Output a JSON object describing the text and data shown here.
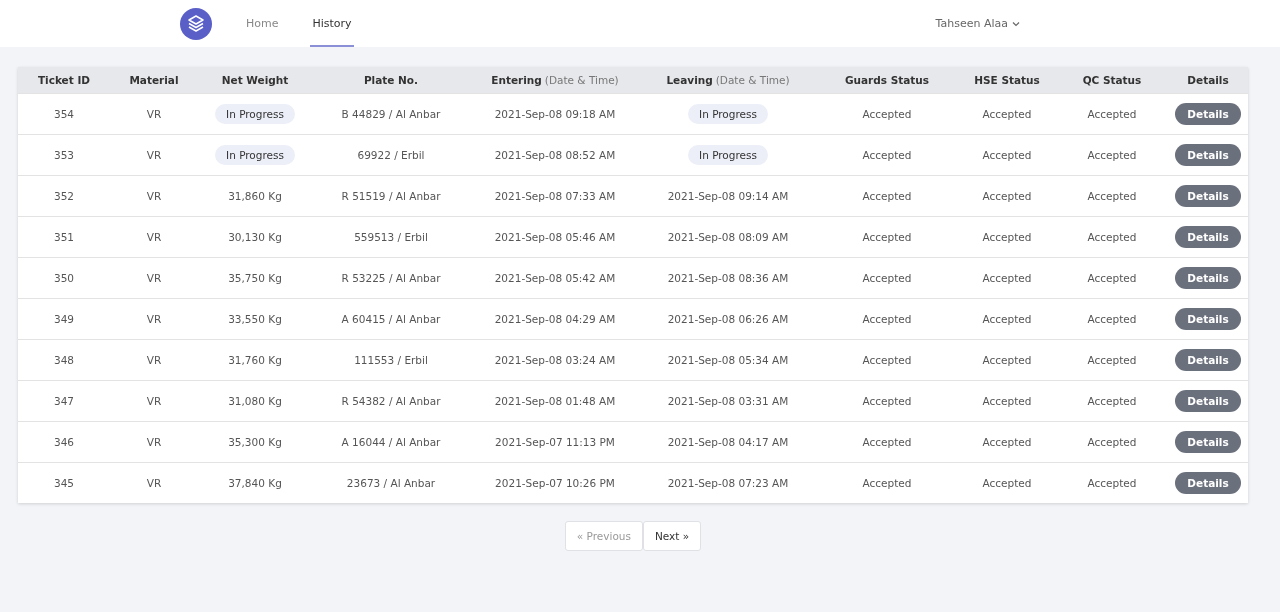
{
  "nav": {
    "links": [
      {
        "label": "Home",
        "selected": false
      },
      {
        "label": "History",
        "selected": true
      }
    ],
    "user": "Tahseen Alaa"
  },
  "table": {
    "columns": [
      {
        "label": "Ticket ID"
      },
      {
        "label": "Material"
      },
      {
        "label": "Net Weight"
      },
      {
        "label": "Plate No."
      },
      {
        "label": "Entering",
        "sub": "(Date & Time)"
      },
      {
        "label": "Leaving",
        "sub": "(Date & Time)"
      },
      {
        "label": "Guards Status"
      },
      {
        "label": "HSE Status"
      },
      {
        "label": "QC Status"
      },
      {
        "label": "Details"
      }
    ],
    "rows": [
      {
        "cells": [
          {
            "kind": "text",
            "text": "354"
          },
          {
            "kind": "text",
            "text": "VR"
          },
          {
            "kind": "pill",
            "text": "In Progress"
          },
          {
            "kind": "text",
            "text": "B 44829 / Al Anbar"
          },
          {
            "kind": "text",
            "text": "2021-Sep-08 09:18 AM"
          },
          {
            "kind": "pill",
            "text": "In Progress"
          },
          {
            "kind": "text",
            "text": "Accepted"
          },
          {
            "kind": "text",
            "text": "Accepted"
          },
          {
            "kind": "text",
            "text": "Accepted"
          },
          {
            "kind": "button",
            "text": "Details"
          }
        ]
      },
      {
        "cells": [
          {
            "kind": "text",
            "text": "353"
          },
          {
            "kind": "text",
            "text": "VR"
          },
          {
            "kind": "pill",
            "text": "In Progress"
          },
          {
            "kind": "text",
            "text": "69922 / Erbil"
          },
          {
            "kind": "text",
            "text": "2021-Sep-08 08:52 AM"
          },
          {
            "kind": "pill",
            "text": "In Progress"
          },
          {
            "kind": "text",
            "text": "Accepted"
          },
          {
            "kind": "text",
            "text": "Accepted"
          },
          {
            "kind": "text",
            "text": "Accepted"
          },
          {
            "kind": "button",
            "text": "Details"
          }
        ]
      },
      {
        "cells": [
          {
            "kind": "text",
            "text": "352"
          },
          {
            "kind": "text",
            "text": "VR"
          },
          {
            "kind": "text",
            "text": "31,860 Kg"
          },
          {
            "kind": "text",
            "text": "R 51519 / Al Anbar"
          },
          {
            "kind": "text",
            "text": "2021-Sep-08 07:33 AM"
          },
          {
            "kind": "text",
            "text": "2021-Sep-08 09:14 AM"
          },
          {
            "kind": "text",
            "text": "Accepted"
          },
          {
            "kind": "text",
            "text": "Accepted"
          },
          {
            "kind": "text",
            "text": "Accepted"
          },
          {
            "kind": "button",
            "text": "Details"
          }
        ]
      },
      {
        "cells": [
          {
            "kind": "text",
            "text": "351"
          },
          {
            "kind": "text",
            "text": "VR"
          },
          {
            "kind": "text",
            "text": "30,130 Kg"
          },
          {
            "kind": "text",
            "text": "559513 / Erbil"
          },
          {
            "kind": "text",
            "text": "2021-Sep-08 05:46 AM"
          },
          {
            "kind": "text",
            "text": "2021-Sep-08 08:09 AM"
          },
          {
            "kind": "text",
            "text": "Accepted"
          },
          {
            "kind": "text",
            "text": "Accepted"
          },
          {
            "kind": "text",
            "text": "Accepted"
          },
          {
            "kind": "button",
            "text": "Details"
          }
        ]
      },
      {
        "cells": [
          {
            "kind": "text",
            "text": "350"
          },
          {
            "kind": "text",
            "text": "VR"
          },
          {
            "kind": "text",
            "text": "35,750 Kg"
          },
          {
            "kind": "text",
            "text": "R 53225 / Al Anbar"
          },
          {
            "kind": "text",
            "text": "2021-Sep-08 05:42 AM"
          },
          {
            "kind": "text",
            "text": "2021-Sep-08 08:36 AM"
          },
          {
            "kind": "text",
            "text": "Accepted"
          },
          {
            "kind": "text",
            "text": "Accepted"
          },
          {
            "kind": "text",
            "text": "Accepted"
          },
          {
            "kind": "button",
            "text": "Details"
          }
        ]
      },
      {
        "cells": [
          {
            "kind": "text",
            "text": "349"
          },
          {
            "kind": "text",
            "text": "VR"
          },
          {
            "kind": "text",
            "text": "33,550 Kg"
          },
          {
            "kind": "text",
            "text": "A 60415 / Al Anbar"
          },
          {
            "kind": "text",
            "text": "2021-Sep-08 04:29 AM"
          },
          {
            "kind": "text",
            "text": "2021-Sep-08 06:26 AM"
          },
          {
            "kind": "text",
            "text": "Accepted"
          },
          {
            "kind": "text",
            "text": "Accepted"
          },
          {
            "kind": "text",
            "text": "Accepted"
          },
          {
            "kind": "button",
            "text": "Details"
          }
        ]
      },
      {
        "cells": [
          {
            "kind": "text",
            "text": "348"
          },
          {
            "kind": "text",
            "text": "VR"
          },
          {
            "kind": "text",
            "text": "31,760 Kg"
          },
          {
            "kind": "text",
            "text": "111553 / Erbil"
          },
          {
            "kind": "text",
            "text": "2021-Sep-08 03:24 AM"
          },
          {
            "kind": "text",
            "text": "2021-Sep-08 05:34 AM"
          },
          {
            "kind": "text",
            "text": "Accepted"
          },
          {
            "kind": "text",
            "text": "Accepted"
          },
          {
            "kind": "text",
            "text": "Accepted"
          },
          {
            "kind": "button",
            "text": "Details"
          }
        ]
      },
      {
        "cells": [
          {
            "kind": "text",
            "text": "347"
          },
          {
            "kind": "text",
            "text": "VR"
          },
          {
            "kind": "text",
            "text": "31,080 Kg"
          },
          {
            "kind": "text",
            "text": "R 54382 / Al Anbar"
          },
          {
            "kind": "text",
            "text": "2021-Sep-08 01:48 AM"
          },
          {
            "kind": "text",
            "text": "2021-Sep-08 03:31 AM"
          },
          {
            "kind": "text",
            "text": "Accepted"
          },
          {
            "kind": "text",
            "text": "Accepted"
          },
          {
            "kind": "text",
            "text": "Accepted"
          },
          {
            "kind": "button",
            "text": "Details"
          }
        ]
      },
      {
        "cells": [
          {
            "kind": "text",
            "text": "346"
          },
          {
            "kind": "text",
            "text": "VR"
          },
          {
            "kind": "text",
            "text": "35,300 Kg"
          },
          {
            "kind": "text",
            "text": "A 16044 / Al Anbar"
          },
          {
            "kind": "text",
            "text": "2021-Sep-07 11:13 PM"
          },
          {
            "kind": "text",
            "text": "2021-Sep-08 04:17 AM"
          },
          {
            "kind": "text",
            "text": "Accepted"
          },
          {
            "kind": "text",
            "text": "Accepted"
          },
          {
            "kind": "text",
            "text": "Accepted"
          },
          {
            "kind": "button",
            "text": "Details"
          }
        ]
      },
      {
        "cells": [
          {
            "kind": "text",
            "text": "345"
          },
          {
            "kind": "text",
            "text": "VR"
          },
          {
            "kind": "text",
            "text": "37,840 Kg"
          },
          {
            "kind": "text",
            "text": "23673 / Al Anbar"
          },
          {
            "kind": "text",
            "text": "2021-Sep-07 10:26 PM"
          },
          {
            "kind": "text",
            "text": "2021-Sep-08 07:23 AM"
          },
          {
            "kind": "text",
            "text": "Accepted"
          },
          {
            "kind": "text",
            "text": "Accepted"
          },
          {
            "kind": "text",
            "text": "Accepted"
          },
          {
            "kind": "button",
            "text": "Details"
          }
        ]
      }
    ]
  },
  "pagination": [
    {
      "label": "« Previous",
      "disabled": true
    },
    {
      "label": "Next »",
      "disabled": false
    }
  ]
}
